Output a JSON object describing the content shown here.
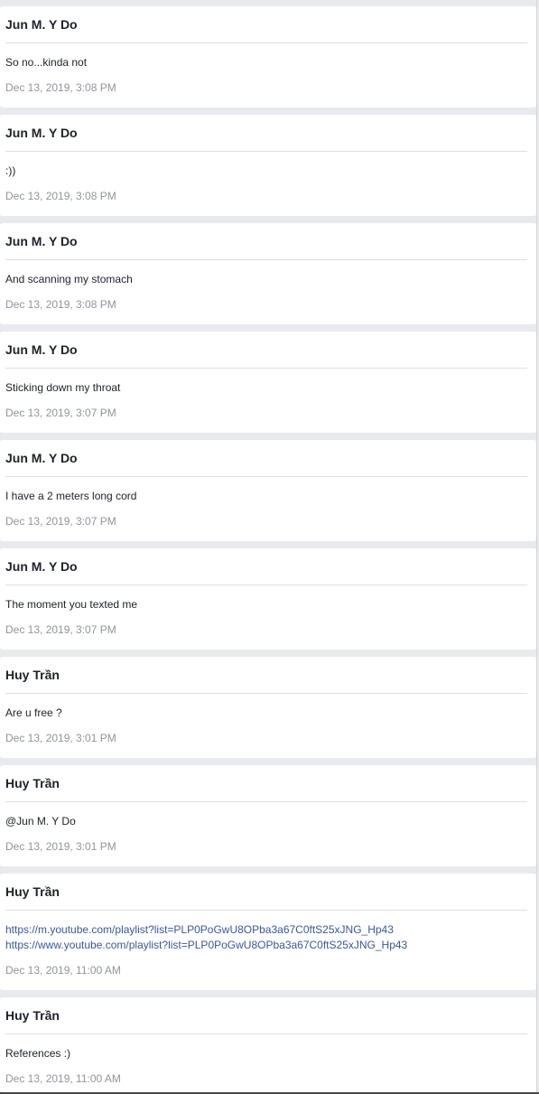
{
  "messages": [
    {
      "sender": "Jun M. Y Do",
      "text": "So no...kinda not",
      "time": "Dec 13, 2019, 3:08 PM"
    },
    {
      "sender": "Jun M. Y Do",
      "text": ":))",
      "time": "Dec 13, 2019, 3:08 PM"
    },
    {
      "sender": "Jun M. Y Do",
      "text": "And scanning my stomach",
      "time": "Dec 13, 2019, 3:08 PM"
    },
    {
      "sender": "Jun M. Y Do",
      "text": "Sticking down my throat",
      "time": "Dec 13, 2019, 3:07 PM"
    },
    {
      "sender": "Jun M. Y Do",
      "text": "I have a 2 meters long cord",
      "time": "Dec 13, 2019, 3:07 PM"
    },
    {
      "sender": "Jun M. Y Do",
      "text": "The moment you texted me",
      "time": "Dec 13, 2019, 3:07 PM"
    },
    {
      "sender": "Huy Trần",
      "text": "Are u free ?",
      "time": "Dec 13, 2019, 3:01 PM"
    },
    {
      "sender": "Huy Trần",
      "text": "@Jun M. Y Do",
      "time": "Dec 13, 2019, 3:01 PM"
    },
    {
      "sender": "Huy Trần",
      "links": [
        "https://m.youtube.com/playlist?list=PLP0PoGwU8OPba3a67C0ftS25xJNG_Hp43",
        "https://www.youtube.com/playlist?list=PLP0PoGwU8OPba3a67C0ftS25xJNG_Hp43"
      ],
      "time": "Dec 13, 2019, 11:00 AM"
    },
    {
      "sender": "Huy Trần",
      "text": "References :)",
      "time": "Dec 13, 2019, 11:00 AM"
    }
  ]
}
